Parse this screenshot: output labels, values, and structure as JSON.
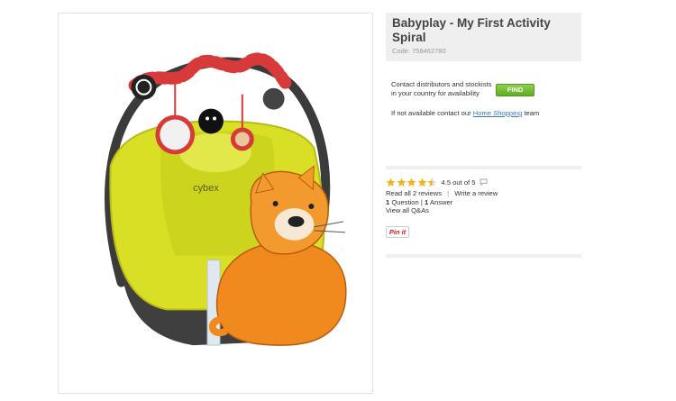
{
  "product": {
    "title": "Babyplay - My First Activity Spiral",
    "code": "Code: 758462780"
  },
  "distributors": {
    "text": "Contact distributors and stockists in your country for availability",
    "find_label": "FIND",
    "home_prefix": "If not available contact our",
    "home_link": "Home Shopping",
    "home_suffix": "team"
  },
  "reviews": {
    "stars": 4.5,
    "rating_text": "4.5 out of 5",
    "read_all": "Read all 2 reviews",
    "separator": "|",
    "write": "Write a review",
    "questions_count": "1",
    "questions_label": "Question",
    "answers_count": "1",
    "answers_label": "Answer",
    "view_all_qa": "View all Q&As"
  },
  "share": {
    "pin_label": "Pin it"
  },
  "colors": {
    "star": "#f2b31e",
    "find_button": "#6bbf2c",
    "link": "#3a77b3",
    "pin": "#cb2027"
  }
}
